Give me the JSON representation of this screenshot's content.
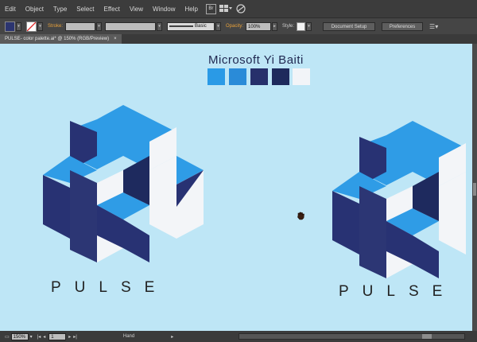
{
  "menubar": {
    "items": [
      "Edit",
      "Object",
      "Type",
      "Select",
      "Effect",
      "View",
      "Window",
      "Help"
    ],
    "br_badge": "Br",
    "icons": [
      "bridge-icon",
      "arrange-documents-icon",
      "gpu-icon"
    ]
  },
  "options": {
    "fill_color": "#2c3570",
    "stroke_label": "Stroke:",
    "brush_label": "Basic",
    "opacity_label": "Opacity:",
    "opacity_value": "100%",
    "style_label": "Style:",
    "doc_setup": "Document Setup",
    "preferences": "Preferences"
  },
  "tab": {
    "title": "PULSE- color palette.ai* @ 150% (RGB/Preview)",
    "close": "×"
  },
  "canvas": {
    "font_label": "Microsoft Yi Baiti",
    "palette": [
      "#2a9ae6",
      "#2a8bd8",
      "#27306b",
      "#1e2a5c",
      "#f2f4f8"
    ],
    "logo_colors": {
      "light": "#2f9ce6",
      "dark": "#283273",
      "white": "#f3f5f8",
      "mid": "#1e2a5e"
    },
    "logo_text_left": "PULSE",
    "logo_text_right": "PULSE"
  },
  "status": {
    "zoom": "150%",
    "page": "1",
    "tool": "Hand"
  }
}
